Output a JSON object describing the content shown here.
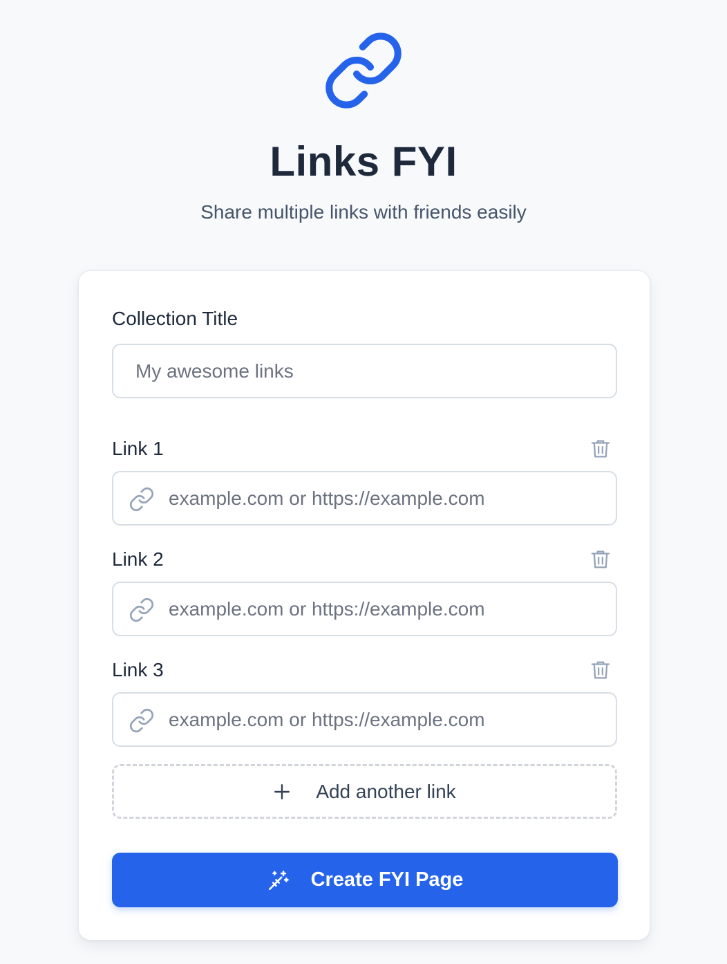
{
  "app": {
    "logo_icon": "link-icon",
    "title": "Links FYI",
    "subtitle": "Share multiple links with friends easily",
    "accent_color": "#2563eb"
  },
  "form": {
    "collection_title_label": "Collection Title",
    "collection_title_placeholder": "My awesome links",
    "collection_title_value": "",
    "links": [
      {
        "label": "Link 1",
        "placeholder": "example.com or https://example.com",
        "value": "",
        "delete_icon": "trash-icon"
      },
      {
        "label": "Link 2",
        "placeholder": "example.com or https://example.com",
        "value": "",
        "delete_icon": "trash-icon"
      },
      {
        "label": "Link 3",
        "placeholder": "example.com or https://example.com",
        "value": "",
        "delete_icon": "trash-icon"
      }
    ],
    "add_link_label": "Add another link",
    "add_link_icon": "plus-icon",
    "create_label": "Create FYI Page",
    "create_icon": "magic-wand-icon"
  }
}
